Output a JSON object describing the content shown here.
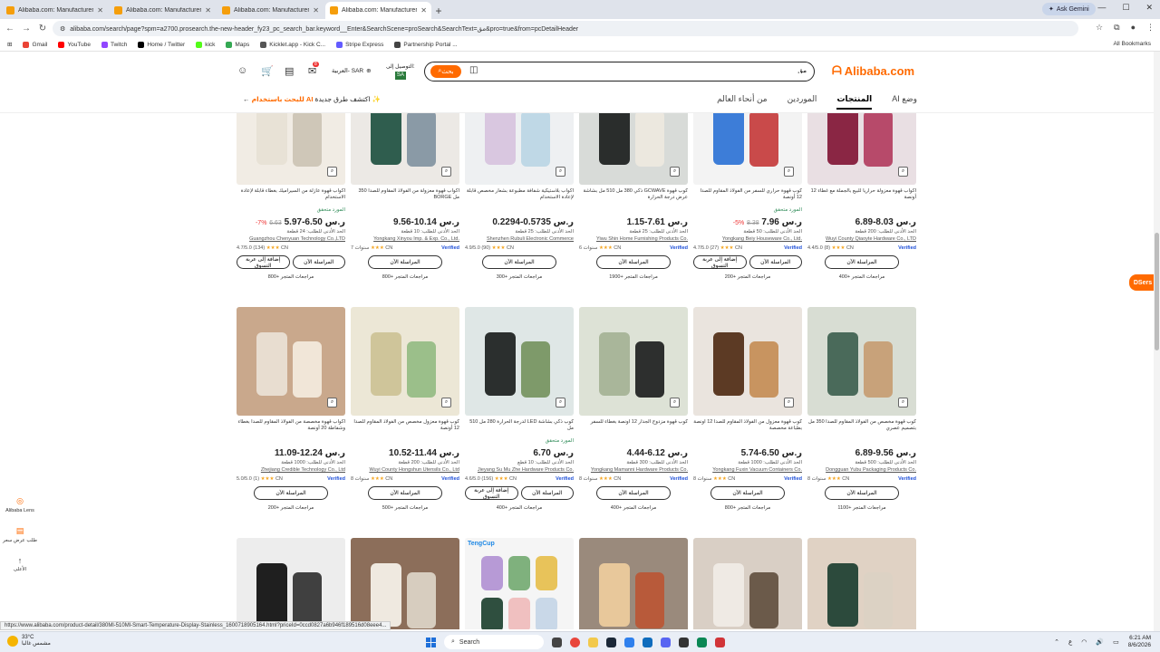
{
  "browser": {
    "tabs": [
      {
        "title": "Alibaba.com: Manufacturers, Su",
        "active": false
      },
      {
        "title": "Alibaba.com: Manufacturers, Su",
        "active": false
      },
      {
        "title": "Alibaba.com: Manufacturers, Su",
        "active": false
      },
      {
        "title": "Alibaba.com: Manufacturers, Su",
        "active": true
      }
    ],
    "gemini_label": "Ask Gemini",
    "url": "alibaba.com/search/page?spm=a2700.prosearch.the-new-header_fy23_pc_search_bar.keyword__Enter&SearchScene=proSearch&SearchText=مق&pro=true&from=pcDetailHeader",
    "bookmarks": [
      "Gmail",
      "YouTube",
      "Twitch",
      "Home / Twitter",
      "kick",
      "Maps",
      "Kicklet.app - Kick C...",
      "Stripe Express",
      "Partnership Portal ..."
    ],
    "all_bookmarks": "All Bookmarks"
  },
  "header": {
    "logo": "Alibaba.com",
    "search_button": "بحث",
    "search_value": "مق",
    "deliver_to": "التوصيل إلى:",
    "country": "SA",
    "currency": "العربية- SAR",
    "cart_count": "8",
    "nav_tabs": [
      "وضع AI",
      "المنتجات",
      "الموردين",
      "من أنحاء العالم"
    ],
    "ai_banner_prefix": "اكتشف طرق جديدة ",
    "ai_banner_link": "للبحث باستخدام AI"
  },
  "products": [
    {
      "title": "أكواب قهوة عازلة من السيراميك بغطاء قابلة لإعادة الاستخدام",
      "badge": "المورد متحقق",
      "price": "5.97-6.50 ر.س",
      "old": "6.63",
      "disc": "-7%",
      "min": "الحد الأدنى للطلب: 24 قطعة",
      "seller": "Guangzhou Chenyuan Technology Co.,LTD",
      "country": "CN",
      "rating": "4.7/5.0 (134)",
      "verified": false,
      "btns": [
        "المراسلة الآن",
        "إضافة إلى عربة التسوق"
      ],
      "reviews": "800+ مراجعات المتجر"
    },
    {
      "title": "أكواب قهوة معزولة من الفولاذ المقاوم للصدأ 350 مل BORGE",
      "badge": "",
      "price": "9.56-10.14 ر.س",
      "old": "",
      "disc": "",
      "min": "الحد الأدنى للطلب: 10 قطعة",
      "seller": "Yongkang Xinyou Imp. & Exp. Co., Ltd.",
      "country": "CN",
      "rating": "7 سنوات",
      "verified": true,
      "btns": [
        "المراسلة الآن"
      ],
      "reviews": "800+ مراجعات المتجر"
    },
    {
      "title": "أكواب بلاستيكية شفافة مطبوعة بشعار مخصص قابلة لإعادة الاستخدام",
      "badge": "",
      "price": "0.2294-0.5735 ر.س",
      "old": "",
      "disc": "",
      "min": "الحد الأدنى للطلب: 25 قطعة",
      "seller": "Shenzhen Rubuli Electronic Commerce",
      "country": "CN",
      "rating": "4.9/5.0 (90)",
      "verified": false,
      "btns": [
        "المراسلة الآن"
      ],
      "reviews": "300+ مراجعات المتجر"
    },
    {
      "title": "كوب قهوة GCWAVE ذكي 380 مل 510 مل بشاشة عرض درجة الحرارة",
      "badge": "",
      "price": "1.15-7.61 ر.س",
      "old": "",
      "disc": "",
      "min": "الحد الأدنى للطلب: 25 قطعة",
      "seller": "Yiwu Shin Home Furnishing Products Co.",
      "country": "CN",
      "rating": "6 سنوات",
      "verified": true,
      "btns": [
        "المراسلة الآن"
      ],
      "reviews": "1900+ مراجعات المتجر"
    },
    {
      "title": "كوب قهوة حراري للسفر من الفولاذ المقاوم للصدأ 12 أونصة",
      "badge": "المورد متحقق",
      "price": "7.96 ر.س",
      "old": "8.38",
      "disc": "-5%",
      "min": "الحد الأدنى للطلب: 50 قطعة",
      "seller": "Yongkang Beiy Houseware Co., Ltd.",
      "country": "CN",
      "rating": "4.7/5.0 (27)",
      "verified": true,
      "btns": [
        "المراسلة الآن",
        "إضافة إلى عربة التسوق"
      ],
      "reviews": "200+ مراجعات المتجر"
    },
    {
      "title": "أكواب قهوة معزولة حراريا للبيع بالجملة مع غطاء 12 أونصة",
      "badge": "",
      "price": "6.89-8.03 ر.س",
      "old": "",
      "disc": "",
      "min": "الحد الأدنى للطلب: 200 قطعة",
      "seller": "Wuyi County Qiaoyte Hardware Co., LTD",
      "country": "CN",
      "rating": "4.4/5.0 (8)",
      "verified": true,
      "btns": [
        "المراسلة الآن"
      ],
      "reviews": "400+ مراجعات المتجر"
    },
    {
      "title": "أكواب قهوة مخصصة من الفولاذ المقاوم للصدأ بغطاء وشفاطة 20 أونصة",
      "badge": "",
      "price": "11.09-12.24 ر.س",
      "old": "",
      "disc": "",
      "min": "الحد الأدنى للطلب: 1000 قطعة",
      "seller": "Zhejiang Credible Technology Co., Ltd",
      "country": "CN",
      "rating": "5.0/5.0 (1)",
      "verified": true,
      "btns": [
        "المراسلة الآن"
      ],
      "reviews": "200+ مراجعات المتجر"
    },
    {
      "title": "كوب قهوة معزول مخصص من الفولاذ المقاوم للصدأ 12 أونصة",
      "badge": "",
      "price": "10.52-11.44 ر.س",
      "old": "",
      "disc": "",
      "min": "الحد الأدنى للطلب: 200 قطعة",
      "seller": "Wuyi County Hongshun Utensils Co., Ltd",
      "country": "CN",
      "rating": "8 سنوات",
      "verified": true,
      "btns": [
        "المراسلة الآن"
      ],
      "reviews": "500+ مراجعات المتجر"
    },
    {
      "title": "كوب ذكي بشاشة LED لدرجة الحرارة 280 مل 510 مل",
      "badge": "المورد متحقق",
      "price": "6.70 ر.س",
      "old": "",
      "disc": "",
      "min": "الحد الأدنى للطلب: 10 قطع",
      "seller": "Jieyang Su Mu Zhe Hardware Products Co.",
      "country": "CN",
      "rating": "4.6/5.0 (156)",
      "verified": true,
      "btns": [
        "المراسلة الآن",
        "إضافة إلى عربة التسوق"
      ],
      "reviews": "400+ مراجعات المتجر"
    },
    {
      "title": "كوب قهوة مزدوج الجدار 12 أونصة بغطاء للسفر",
      "badge": "",
      "price": "4.44-6.12 ر.س",
      "old": "",
      "disc": "",
      "min": "الحد الأدنى للطلب: 300 قطعة",
      "seller": "Yongkang Mamanni Hardware Products Co.",
      "country": "CN",
      "rating": "8 سنوات",
      "verified": true,
      "btns": [
        "المراسلة الآن"
      ],
      "reviews": "400+ مراجعات المتجر"
    },
    {
      "title": "كوب قهوة معزول من الفولاذ المقاوم للصدأ 12 أونصة بطباعة مخصصة",
      "badge": "",
      "price": "5.74-6.50 ر.س",
      "old": "",
      "disc": "",
      "min": "الحد الأدنى للطلب: 1000 قطعة",
      "seller": "Yongkang Fuxin Vacuum Containers Co.",
      "country": "CN",
      "rating": "8 سنوات",
      "verified": true,
      "btns": [
        "المراسلة الآن"
      ],
      "reviews": "800+ مراجعات المتجر"
    },
    {
      "title": "كوب قهوة مخصص من الفولاذ المقاوم للصدأ 350 مل بتصميم عصري",
      "badge": "",
      "price": "6.89-9.56 ر.س",
      "old": "",
      "disc": "",
      "min": "الحد الأدنى للطلب: 500 قطعة",
      "seller": "Dongguan Yubu Packaging Products Co.",
      "country": "CN",
      "rating": "8 سنوات",
      "verified": true,
      "btns": [
        "المراسلة الآن"
      ],
      "reviews": "1100+ مراجعات المتجر"
    },
    {
      "title": "",
      "badge": "",
      "price": "",
      "old": "",
      "disc": "",
      "min": "",
      "seller": "",
      "country": "",
      "rating": "",
      "verified": false,
      "btns": [],
      "reviews": ""
    },
    {
      "title": "",
      "badge": "",
      "price": "",
      "old": "",
      "disc": "",
      "min": "",
      "seller": "",
      "country": "",
      "rating": "",
      "verified": false,
      "btns": [],
      "reviews": ""
    },
    {
      "title": "",
      "badge": "TengCup",
      "price": "",
      "old": "",
      "disc": "",
      "min": "",
      "seller": "",
      "country": "",
      "rating": "",
      "verified": false,
      "btns": [],
      "reviews": ""
    },
    {
      "title": "",
      "badge": "",
      "price": "",
      "old": "",
      "disc": "",
      "min": "",
      "seller": "",
      "country": "",
      "rating": "",
      "verified": false,
      "btns": [],
      "reviews": ""
    },
    {
      "title": "",
      "badge": "",
      "price": "",
      "old": "",
      "disc": "",
      "min": "",
      "seller": "",
      "country": "",
      "rating": "",
      "verified": false,
      "btns": [],
      "reviews": ""
    },
    {
      "title": "",
      "badge": "",
      "price": "",
      "old": "",
      "disc": "",
      "min": "",
      "seller": "",
      "country": "",
      "rating": "",
      "verified": false,
      "btns": [],
      "reviews": ""
    }
  ],
  "product_colors": [
    [
      "#f1ece4",
      "#e8e2d6",
      "#cfc7b8"
    ],
    [
      "#ece9e5",
      "#2f5d4e",
      "#8a9aa6"
    ],
    [
      "#eef0f2",
      "#d9c7e0",
      "#bfd8e6"
    ],
    [
      "#d8dbd8",
      "#2a2d2c",
      "#ece8df"
    ],
    [
      "#f3f3f3",
      "#3d7dd8",
      "#c94a4a"
    ],
    [
      "#e9dfe3",
      "#8a2644",
      "#b74a6a"
    ],
    [
      "#c9a88c",
      "#e8ddd0",
      "#f1e6d8"
    ],
    [
      "#ece7d6",
      "#cfc59a",
      "#9bbf8a"
    ],
    [
      "#dfe7e6",
      "#2b2f2e",
      "#7e9a6a"
    ],
    [
      "#dde2d6",
      "#a9b69a",
      "#2d2f2e"
    ],
    [
      "#eae4de",
      "#5c3a24",
      "#c89460"
    ],
    [
      "#d8ddd3",
      "#4a6a5a",
      "#c8a27a"
    ],
    [
      "#ededed",
      "#1f1f1f",
      "#404040"
    ],
    [
      "#8c6e5a",
      "#efe9e0",
      "#d7cdbf"
    ],
    [
      "#f5f5f5",
      "#b79ad6",
      "#7fb17d"
    ],
    [
      "#9a8a7c",
      "#e8c89b",
      "#b85a3a"
    ],
    [
      "#d9cfc5",
      "#efeae4",
      "#6b5a4a"
    ],
    [
      "#e0d2c4",
      "#2c4a3c",
      "#dcd2c4"
    ]
  ],
  "float": {
    "dsers": "DSers"
  },
  "sidebar": [
    {
      "icon": "◎",
      "label": "Alibaba Lens"
    },
    {
      "icon": "▤",
      "label": "طلب عرض سعر"
    },
    {
      "icon": "↑",
      "label": "الأعلى"
    }
  ],
  "status_url": "https://www.alibaba.com/product-detail/380Ml-510Ml-Smart-Temperature-Display-Stainless_1600718905164.html?priceId=0ccd0827a6b946f189516d08eee4...",
  "taskbar": {
    "temp": "33°C",
    "weather": "مشمس غالبا",
    "search": "Search",
    "lang": "ع",
    "time": "6:21 AM",
    "date": "8/6/2026"
  }
}
